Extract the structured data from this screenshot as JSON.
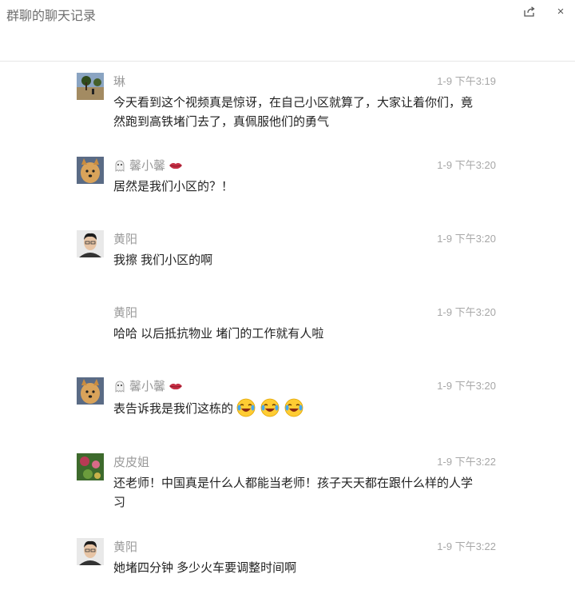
{
  "window": {
    "title": "群聊的聊天记录",
    "share_icon": "share-icon",
    "close_label": "×"
  },
  "messages": [
    {
      "sender": "琳",
      "time": "1-9 下午3:19",
      "text": "今天看到这个视频真是惊讶，在自己小区就算了，大家让着你们，竟然跑到高铁堵门去了，真佩服他们的勇气",
      "avatar": "landscape-avatar"
    },
    {
      "sender": "馨小馨",
      "time": "1-9 下午3:20",
      "text": "居然是我们小区的？！",
      "avatar": "dog-avatar"
    },
    {
      "sender": "黄阳",
      "time": "1-9 下午3:20",
      "text": "我擦 我们小区的啊",
      "avatar": "man-avatar"
    },
    {
      "sender": "黄阳",
      "time": "1-9 下午3:20",
      "text": "哈哈 以后抵抗物业 堵门的工作就有人啦",
      "avatar": ""
    },
    {
      "sender": "馨小馨",
      "time": "1-9 下午3:20",
      "text": "表告诉我是我们这栋的",
      "avatar": "dog-avatar"
    },
    {
      "sender": "皮皮姐",
      "time": "1-9 下午3:22",
      "text": "还老师！中国真是什么人都能当老师！孩子天天都在跟什么样的人学习",
      "avatar": "flower-avatar"
    },
    {
      "sender": "黄阳",
      "time": "1-9 下午3:22",
      "text": "她堵四分钟 多少火车要调整时间啊",
      "avatar": "man-avatar"
    }
  ]
}
